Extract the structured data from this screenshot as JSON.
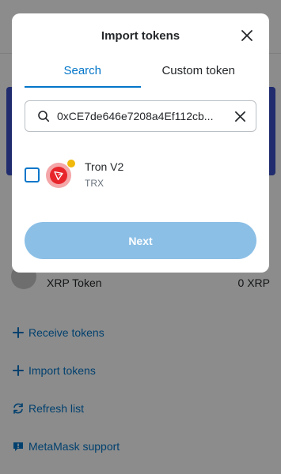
{
  "modal": {
    "title": "Import tokens",
    "tabs": [
      {
        "label": "Search",
        "active": true
      },
      {
        "label": "Custom token",
        "active": false
      }
    ],
    "search": {
      "value": "0xCE7de646e7208a4Ef112cb..."
    },
    "results": [
      {
        "name": "Tron V2",
        "symbol": "TRX",
        "checked": false
      }
    ],
    "next_label": "Next"
  },
  "background": {
    "token": {
      "name": "XRP Token",
      "amount": "0 XRP"
    },
    "links": [
      {
        "label": "Receive tokens",
        "icon": "plus-icon"
      },
      {
        "label": "Import tokens",
        "icon": "plus-icon"
      },
      {
        "label": "Refresh list",
        "icon": "refresh-icon"
      },
      {
        "label": "MetaMask support",
        "icon": "chat-icon"
      }
    ]
  },
  "colors": {
    "accent": "#0376c9",
    "next_disabled": "#8bbfe6",
    "tron_red": "#e8242b",
    "badge_yellow": "#f0b90b"
  }
}
